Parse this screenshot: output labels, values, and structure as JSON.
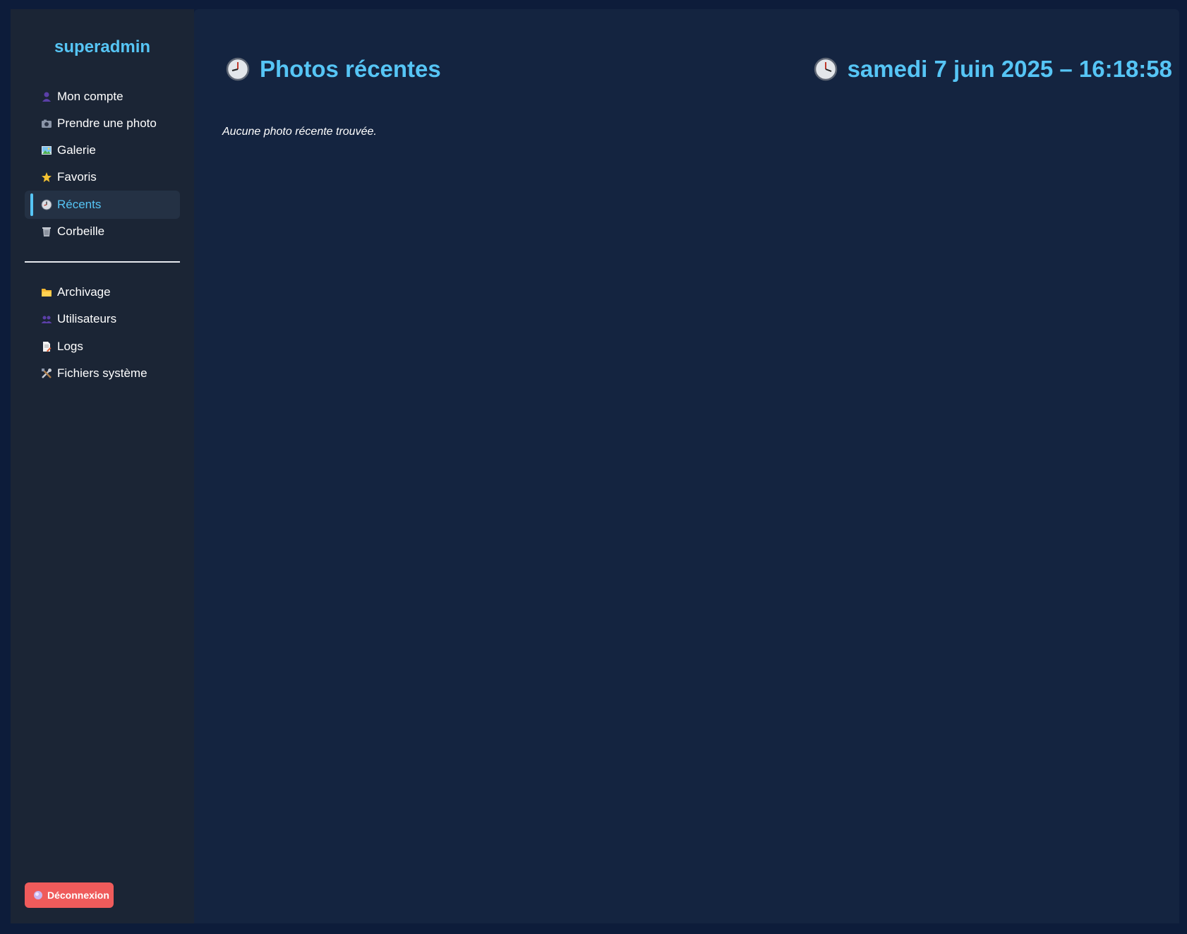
{
  "sidebar": {
    "username": "superadmin",
    "items": [
      {
        "label": "Mon compte",
        "icon": "user-icon"
      },
      {
        "label": "Prendre une photo",
        "icon": "camera-icon"
      },
      {
        "label": "Galerie",
        "icon": "picture-icon"
      },
      {
        "label": "Favoris",
        "icon": "star-icon"
      },
      {
        "label": "Récents",
        "icon": "clock-icon",
        "active": true
      },
      {
        "label": "Corbeille",
        "icon": "trash-icon"
      }
    ],
    "admin_items": [
      {
        "label": "Archivage",
        "icon": "folder-icon"
      },
      {
        "label": "Utilisateurs",
        "icon": "users-icon"
      },
      {
        "label": "Logs",
        "icon": "document-icon"
      },
      {
        "label": "Fichiers système",
        "icon": "tools-icon"
      }
    ],
    "logout_label": "Déconnexion"
  },
  "main": {
    "title": "Photos récentes",
    "datetime": "samedi 7 juin 2025 – 16:18:58",
    "empty_message": "Aucune photo récente trouvée."
  },
  "colors": {
    "accent": "#56c5f5",
    "sidebar_bg": "#1b2535",
    "main_bg": "#142440",
    "logout_bg": "#ef5b5b"
  }
}
